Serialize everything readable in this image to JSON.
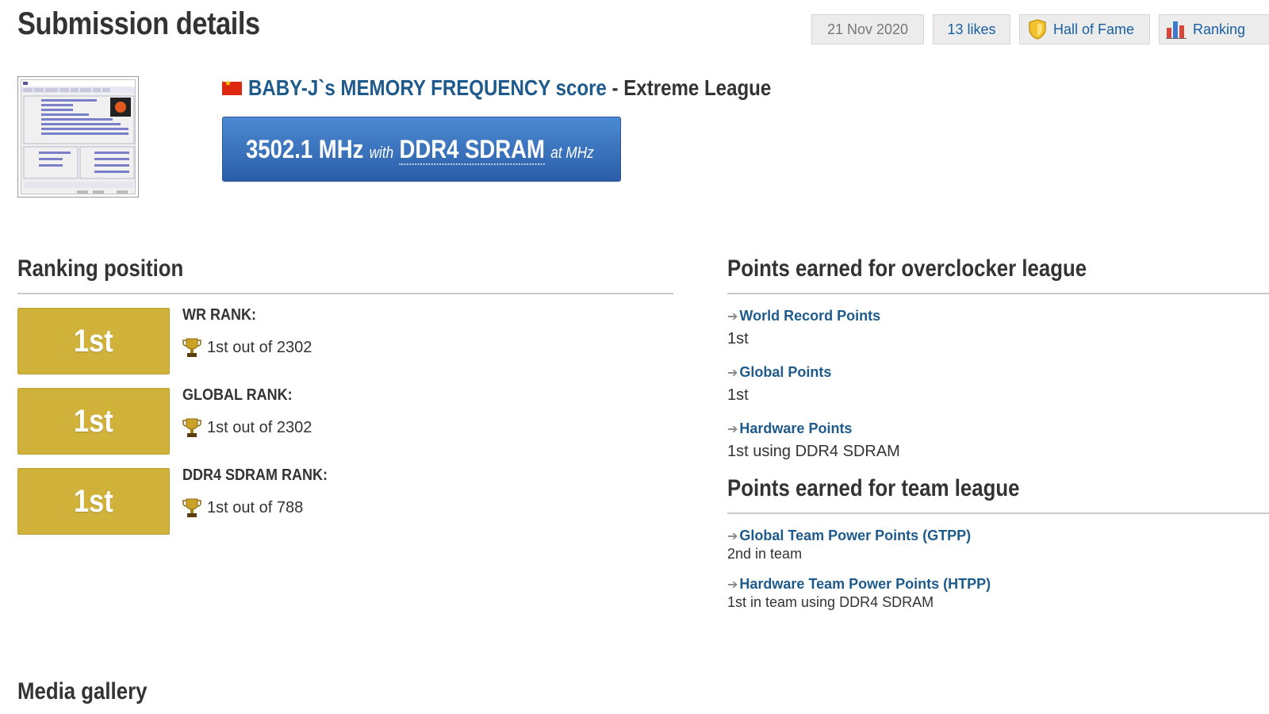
{
  "header": {
    "title": "Submission details",
    "date": "21 Nov 2020",
    "likes": "13 likes",
    "hall_of_fame": "Hall of Fame",
    "ranking": "Ranking"
  },
  "submission": {
    "user_score": "BABY-J`s MEMORY FREQUENCY score",
    "league": "- Extreme League",
    "score_value": "3502.1 MHz",
    "with_label": "with",
    "hardware": "DDR4 SDRAM",
    "at_label": "at MHz"
  },
  "ranking": {
    "title": "Ranking position",
    "rows": [
      {
        "badge": "1st",
        "label": "WR RANK:",
        "value": "1st out of 2302"
      },
      {
        "badge": "1st",
        "label": "GLOBAL RANK:",
        "value": "1st out of 2302"
      },
      {
        "badge": "1st",
        "label": "DDR4 SDRAM RANK:",
        "value": "1st out of 788"
      }
    ]
  },
  "overclocker_points": {
    "title": "Points earned for overclocker league",
    "items": [
      {
        "label": "World Record Points",
        "value": "1st"
      },
      {
        "label": "Global Points",
        "value": "1st"
      },
      {
        "label": "Hardware Points",
        "value": "1st using DDR4 SDRAM"
      }
    ]
  },
  "team_points": {
    "title": "Points earned for team league",
    "items": [
      {
        "label": "Global Team Power Points (GTPP)",
        "value": "2nd in team"
      },
      {
        "label": "Hardware Team Power Points (HTPP)",
        "value": "1st in team using DDR4 SDRAM"
      }
    ]
  },
  "media": {
    "title": "Media gallery"
  },
  "colors": {
    "accent": "#1e5b8c",
    "score_box": "#3a72c0",
    "rank_gold": "#d0b23a"
  },
  "icons": [
    "china-flag-icon",
    "shield-icon",
    "bar-chart-icon",
    "trophy-icon",
    "arrow-right-icon"
  ]
}
